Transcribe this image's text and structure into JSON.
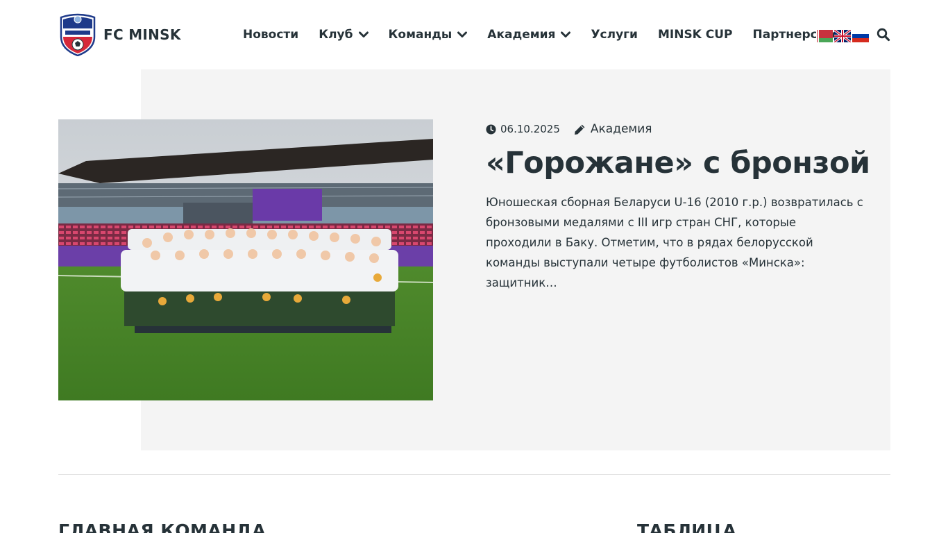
{
  "header": {
    "site_title": "FC MINSK",
    "nav": [
      {
        "label": "Новости",
        "has_dropdown": false
      },
      {
        "label": "Клуб",
        "has_dropdown": true
      },
      {
        "label": "Команды",
        "has_dropdown": true
      },
      {
        "label": "Академия",
        "has_dropdown": true
      },
      {
        "label": "Услуги",
        "has_dropdown": false
      },
      {
        "label": "MINSK CUP",
        "has_dropdown": false
      },
      {
        "label": "Партнерство",
        "has_dropdown": false
      }
    ],
    "languages": [
      "by-flag-icon",
      "uk-flag-icon",
      "ru-flag-icon"
    ],
    "search_icon": "search-icon"
  },
  "featured_post": {
    "date": "06.10.2025",
    "category": "Академия",
    "title": "«Горожане» с бронзой",
    "excerpt": "Юношеская сборная Беларуси U-16 (2010 г.р.) возвратилась с бронзовыми медалями с III игр стран СНГ, которые проходили в Баку. Отметим, что в рядах белорусской команды выступали четыре футболистов «Минска»: защитник…"
  },
  "sections": {
    "main_team": "ГЛАВНАЯ КОМАНДА",
    "table": "ТАБЛИЦА"
  },
  "colors": {
    "text": "#263238",
    "hero_bg": "#f4f4f4",
    "divider": "#dddddd",
    "club_red": "#d62839",
    "club_blue": "#1e3a8a"
  }
}
